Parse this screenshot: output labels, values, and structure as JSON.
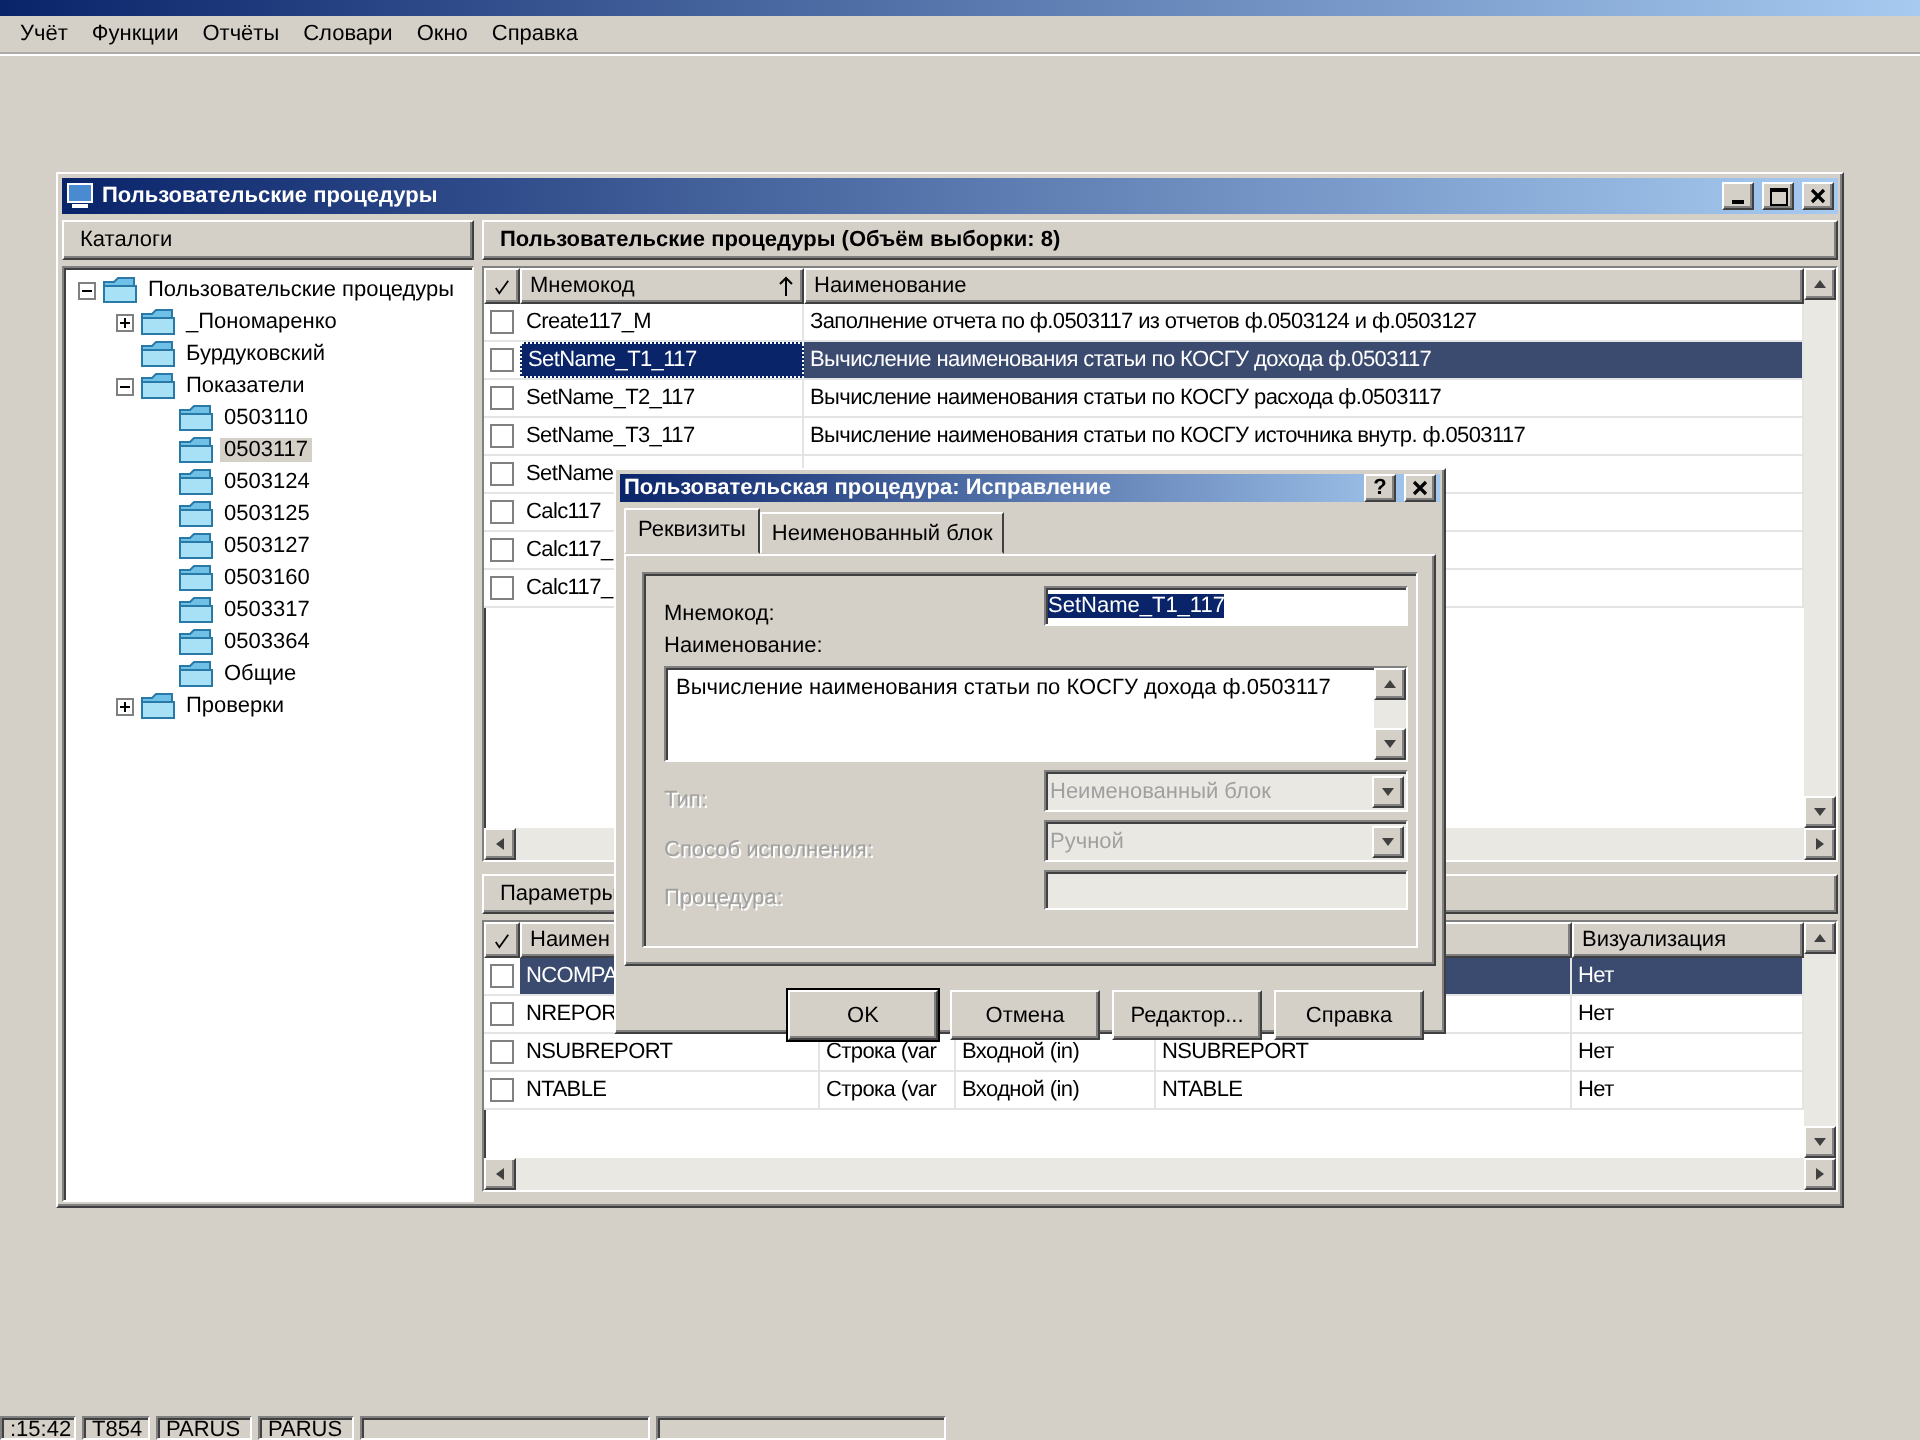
{
  "menu": [
    "Учёт",
    "Функции",
    "Отчёты",
    "Словари",
    "Окно",
    "Справка"
  ],
  "window": {
    "title": "Пользовательские процедуры"
  },
  "catalog": {
    "title": "Каталоги",
    "tree": [
      {
        "label": "Пользовательские процедуры",
        "selected": false,
        "expanded": true,
        "children": [
          {
            "label": "_Пономаренко",
            "selected": false,
            "expanded": false
          },
          {
            "label": "Бурдуковский",
            "selected": false
          },
          {
            "label": "Показатели",
            "selected": false,
            "expanded": true,
            "children": [
              {
                "label": "0503110",
                "selected": false
              },
              {
                "label": "0503117",
                "selected": true
              },
              {
                "label": "0503124",
                "selected": false
              },
              {
                "label": "0503125",
                "selected": false
              },
              {
                "label": "0503127",
                "selected": false
              },
              {
                "label": "0503160",
                "selected": false
              },
              {
                "label": "0503317",
                "selected": false
              },
              {
                "label": "0503364",
                "selected": false
              },
              {
                "label": "Общие",
                "selected": false
              }
            ]
          },
          {
            "label": "Проверки",
            "selected": false,
            "expanded": false
          }
        ]
      }
    ]
  },
  "procedures": {
    "title": "Пользовательские процедуры (Объём выборки: 8)",
    "columns": [
      "Мнемокод",
      "Наименование"
    ],
    "rows": [
      {
        "checked": false,
        "selected": false,
        "code": "Create117_M",
        "name": "Заполнение отчета по ф.0503117 из отчетов ф.0503124 и ф.0503127"
      },
      {
        "checked": false,
        "selected": true,
        "code": "SetName_T1_117",
        "name": "Вычисление наименования статьи по КОСГУ дохода ф.0503117"
      },
      {
        "checked": false,
        "selected": false,
        "code": "SetName_T2_117",
        "name": "Вычисление наименования статьи по КОСГУ расхода ф.0503117"
      },
      {
        "checked": false,
        "selected": false,
        "code": "SetName_T3_117",
        "name": "Вычисление наименования статьи по КОСГУ источника внутр. ф.0503117"
      },
      {
        "checked": false,
        "selected": false,
        "code": "SetName"
      },
      {
        "checked": false,
        "selected": false,
        "code": "Calc117"
      },
      {
        "checked": false,
        "selected": false,
        "code": "Calc117_"
      },
      {
        "checked": false,
        "selected": false,
        "code": "Calc117_"
      }
    ]
  },
  "parameters": {
    "title": "Параметры",
    "header": {
      "column_1": "Наимен",
      "column_5": "Визуализация"
    },
    "rows": [
      {
        "checked": false,
        "selected": true,
        "column_1": "NCOMPA",
        "column_5": "Нет"
      },
      {
        "checked": false,
        "selected": false,
        "column_1": "NREPOR",
        "column_5": "Нет"
      },
      {
        "checked": false,
        "selected": false,
        "column_1": "NSUBREPORT",
        "column_2": "Строка (var",
        "column_3": "Входной (in)",
        "column_4": "NSUBREPORT",
        "column_5": "Нет"
      },
      {
        "checked": false,
        "selected": false,
        "column_1": "NTABLE",
        "column_2": "Строка (var",
        "column_3": "Входной (in)",
        "column_4": "NTABLE",
        "column_5": "Нет"
      }
    ]
  },
  "dialog": {
    "title": "Пользовательская процедура: Исправление",
    "help": "?",
    "tabs": [
      {
        "label": "Реквизиты",
        "selected": true
      },
      {
        "label": "Неименованный блок",
        "selected": false
      }
    ],
    "fields": [
      {
        "kind": "text",
        "label": "Мнемокод:",
        "value": "SetName_T1_117",
        "disabled": false,
        "highlighted": true
      },
      {
        "kind": "textarea",
        "label": "Наименование:",
        "value": "Вычисление наименования статьи по КОСГУ дохода ф.0503117",
        "disabled": false
      },
      {
        "kind": "select",
        "label": "Тип:",
        "value": "Неименованный блок",
        "disabled": true
      },
      {
        "kind": "select",
        "label": "Способ исполнения:",
        "value": "Ручной",
        "disabled": true
      },
      {
        "kind": "text",
        "label": "Процедура:",
        "disabled": true
      }
    ],
    "buttons": [
      {
        "label": "OK",
        "default": true
      },
      {
        "label": "Отмена",
        "default": false
      },
      {
        "label": "Редактор...",
        "default": false
      },
      {
        "label": "Справка",
        "default": false
      }
    ]
  },
  "status_bar": [
    ":15:42",
    "T854",
    "PARUS",
    "PARUS"
  ]
}
